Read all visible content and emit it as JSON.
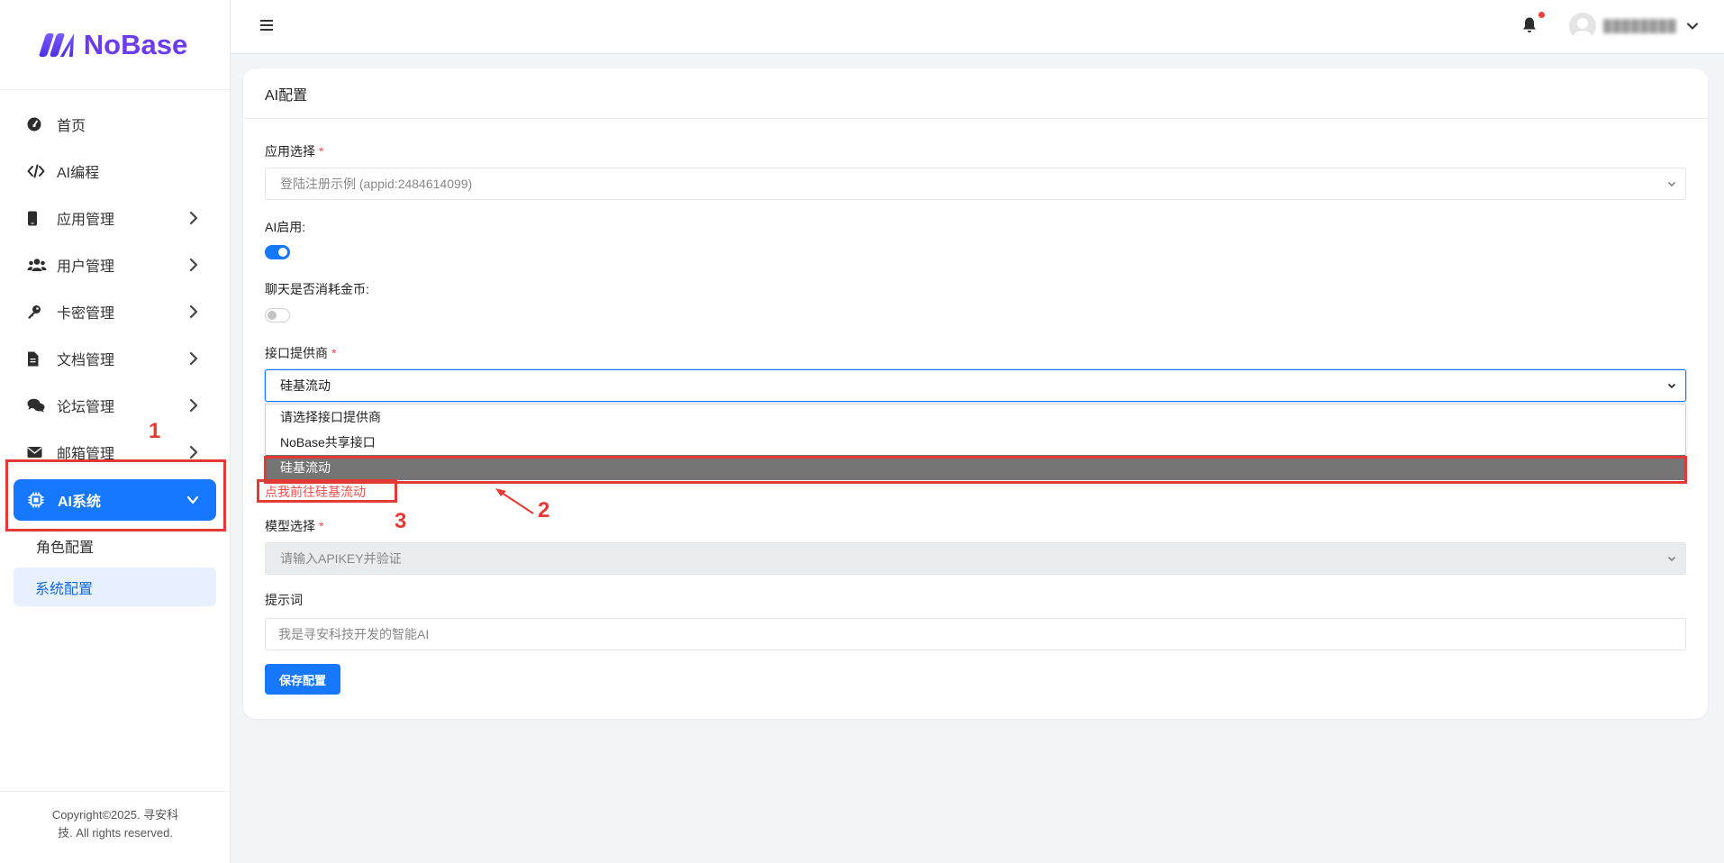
{
  "brand": {
    "name": "NoBase"
  },
  "sidebar": {
    "items": [
      {
        "label": "首页",
        "icon": "dashboard-icon"
      },
      {
        "label": "AI编程",
        "icon": "code-icon"
      },
      {
        "label": "应用管理",
        "icon": "mobile-icon"
      },
      {
        "label": "用户管理",
        "icon": "users-icon"
      },
      {
        "label": "卡密管理",
        "icon": "key-icon"
      },
      {
        "label": "文档管理",
        "icon": "file-icon"
      },
      {
        "label": "论坛管理",
        "icon": "comments-icon"
      },
      {
        "label": "邮箱管理",
        "icon": "envelope-icon"
      },
      {
        "label": "AI系统",
        "icon": "chip-icon",
        "active": true
      }
    ],
    "subitems": [
      {
        "label": "角色配置"
      },
      {
        "label": "系统配置",
        "selected": true
      }
    ],
    "copyright_line1": "Copyright©2025. 寻安科",
    "copyright_line2": "技. All rights reserved."
  },
  "topbar": {
    "username": "████████"
  },
  "card": {
    "title": "AI配置",
    "app_select": {
      "label": "应用选择",
      "required_mark": "*",
      "value": "登陆注册示例 (appid:2484614099)"
    },
    "ai_enable": {
      "label": "AI启用:",
      "on": true
    },
    "chat_coin": {
      "label": "聊天是否消耗金币:",
      "on": false
    },
    "provider": {
      "label": "接口提供商",
      "required_mark": "*",
      "value": "硅基流动",
      "options": [
        "请选择接口提供商",
        "NoBase共享接口",
        "硅基流动"
      ],
      "highlighted_index": 2
    },
    "provider_link": "点我前往硅基流动",
    "model_select": {
      "label": "模型选择",
      "required_mark": "*",
      "value": "请输入APIKEY并验证"
    },
    "prompt": {
      "label": "提示词",
      "placeholder": "我是寻安科技开发的智能AI"
    },
    "save_button": "保存配置"
  },
  "annotations": {
    "n1": "1",
    "n2": "2",
    "n3": "3"
  },
  "colors": {
    "primary": "#1677ff",
    "brand": "#6d3bef",
    "annotation": "#e53935",
    "link_red": "#f0514f",
    "highlight_gray": "#757575"
  }
}
